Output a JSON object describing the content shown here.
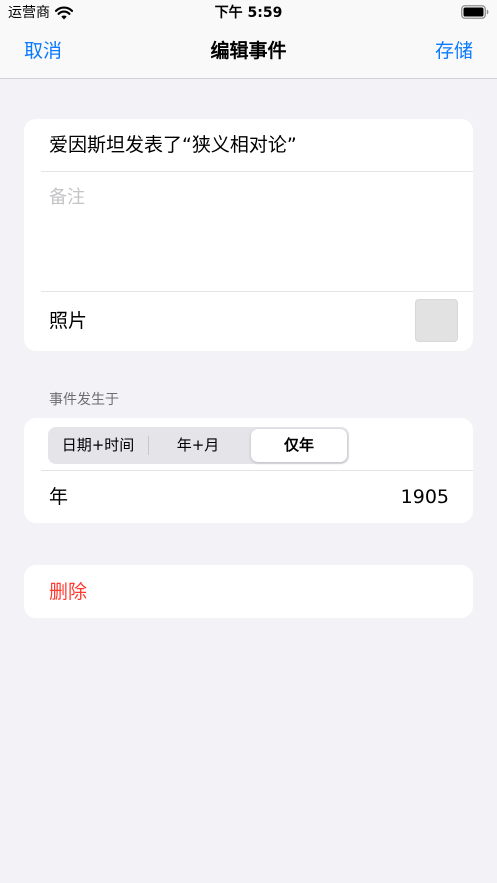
{
  "status_bar": {
    "carrier": "运营商",
    "time": "下午 5:59",
    "battery_level": 1.0
  },
  "nav": {
    "cancel_label": "取消",
    "title": "编辑事件",
    "save_label": "存储"
  },
  "event": {
    "title": "爱因斯坦发表了“狭义相对论”",
    "notes_placeholder": "备注",
    "photo_label": "照片"
  },
  "date_section": {
    "header": "事件发生于",
    "segments": [
      "日期+时间",
      "年+月",
      "仅年"
    ],
    "selected_segment": "仅年",
    "year_label": "年",
    "year_value": "1905"
  },
  "actions": {
    "delete_label": "删除"
  },
  "colors": {
    "accent": "#0a7aff",
    "destructive": "#ff3b30",
    "background": "#f2f2f7"
  },
  "icons": [
    "wifi-icon",
    "battery-icon"
  ]
}
